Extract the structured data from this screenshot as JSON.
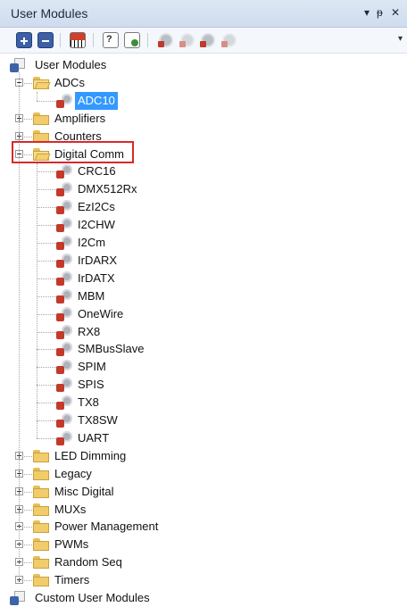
{
  "window": {
    "title": "User Modules",
    "controls": [
      "▾",
      "ᵽ",
      "✕"
    ]
  },
  "toolbar": {
    "buttons": [
      "expand-all",
      "collapse-all",
      "select-map",
      "help",
      "datasheet",
      "place-module",
      "unplace-module",
      "add-module",
      "module-settings"
    ],
    "overflow": "▾"
  },
  "tree": {
    "root_label": "User Modules",
    "groups": [
      {
        "label": "ADCs",
        "expanded": true,
        "children": [
          "ADC10"
        ]
      },
      {
        "label": "Amplifiers",
        "expanded": false,
        "children": []
      },
      {
        "label": "Counters",
        "expanded": false,
        "children": []
      },
      {
        "label": "Digital Comm",
        "expanded": true,
        "children": [
          "CRC16",
          "DMX512Rx",
          "EzI2Cs",
          "I2CHW",
          "I2Cm",
          "IrDARX",
          "IrDATX",
          "MBM",
          "OneWire",
          "RX8",
          "SMBusSlave",
          "SPIM",
          "SPIS",
          "TX8",
          "TX8SW",
          "UART"
        ]
      },
      {
        "label": "LED Dimming",
        "expanded": false,
        "children": []
      },
      {
        "label": "Legacy",
        "expanded": false,
        "children": []
      },
      {
        "label": "Misc Digital",
        "expanded": false,
        "children": []
      },
      {
        "label": "MUXs",
        "expanded": false,
        "children": []
      },
      {
        "label": "Power Management",
        "expanded": false,
        "children": []
      },
      {
        "label": "PWMs",
        "expanded": false,
        "children": []
      },
      {
        "label": "Random Seq",
        "expanded": false,
        "children": []
      },
      {
        "label": "Timers",
        "expanded": false,
        "children": []
      }
    ],
    "footer_label": "Custom User Modules",
    "selected": "ADC10",
    "highlighted_group": "Digital Comm"
  },
  "colors": {
    "selection": "#3399ff",
    "highlight_box": "#d62a2a"
  }
}
